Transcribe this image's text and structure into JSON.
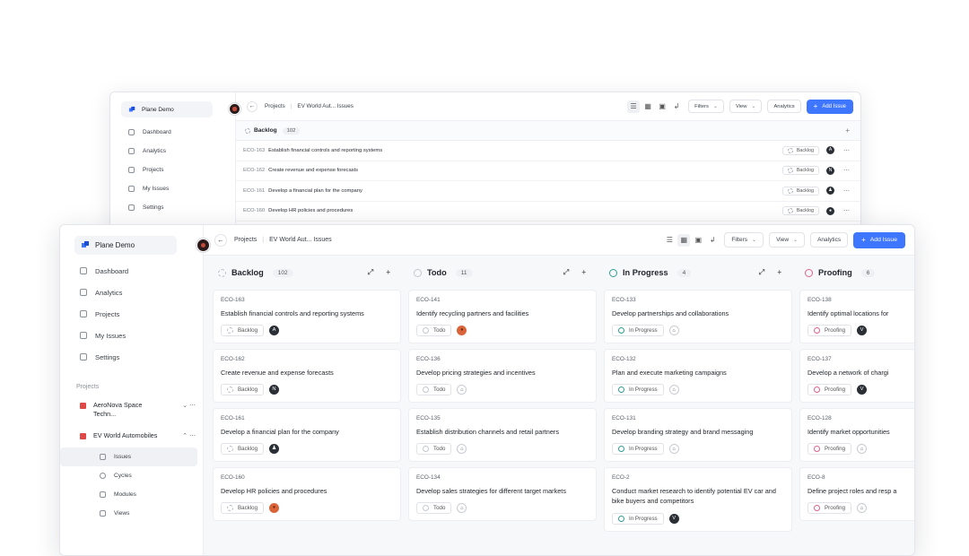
{
  "workspace": {
    "name": "Plane Demo"
  },
  "nav": [
    {
      "label": "Dashboard",
      "icon": "dashboard-icon"
    },
    {
      "label": "Analytics",
      "icon": "analytics-icon"
    },
    {
      "label": "Projects",
      "icon": "projects-icon"
    },
    {
      "label": "My Issues",
      "icon": "my-issues-icon"
    },
    {
      "label": "Settings",
      "icon": "settings-icon"
    }
  ],
  "sidebar": {
    "projects_heading": "Projects",
    "projects": [
      {
        "name": "AeroNova Space Techn...",
        "color": "#e04848",
        "expanded": false
      },
      {
        "name": "EV World Automobiles",
        "color": "#e04848",
        "expanded": true
      }
    ],
    "subnav": [
      {
        "label": "Issues",
        "icon": "issues-icon",
        "active": true
      },
      {
        "label": "Cycles",
        "icon": "cycles-icon",
        "active": false
      },
      {
        "label": "Modules",
        "icon": "modules-icon",
        "active": false
      },
      {
        "label": "Views",
        "icon": "views-icon",
        "active": false
      }
    ]
  },
  "header": {
    "crumb_projects": "Projects",
    "crumb_current": "EV World Aut... Issues",
    "filters_label": "Filters",
    "view_label": "View",
    "analytics_label": "Analytics",
    "add_issue_label": "Add Issue",
    "accent": "#3f76ff"
  },
  "list_view": {
    "group": "Backlog",
    "count": "102",
    "rows": [
      {
        "id": "ECO-163",
        "title": "Establish financial controls and reporting systems",
        "state": "Backlog",
        "assignee": "A"
      },
      {
        "id": "ECO-162",
        "title": "Create revenue and expense forecasts",
        "state": "Backlog",
        "assignee": "N"
      },
      {
        "id": "ECO-161",
        "title": "Develop a financial plan for the company",
        "state": "Backlog",
        "assignee": "♟"
      },
      {
        "id": "ECO-160",
        "title": "Develop HR policies and procedures",
        "state": "Backlog",
        "assignee": "●"
      }
    ]
  },
  "board": {
    "columns": [
      {
        "name": "Backlog",
        "count": "102",
        "color": "#b7bcc4",
        "dashed": true,
        "cards": [
          {
            "id": "ECO-163",
            "title": "Establish financial controls and reporting systems",
            "state": "Backlog",
            "assignee": "A"
          },
          {
            "id": "ECO-162",
            "title": "Create revenue and expense forecasts",
            "state": "Backlog",
            "assignee": "N"
          },
          {
            "id": "ECO-161",
            "title": "Develop a financial plan for the company",
            "state": "Backlog",
            "assignee": "♟"
          },
          {
            "id": "ECO-160",
            "title": "Develop HR policies and procedures",
            "state": "Backlog",
            "assignee": "●"
          }
        ]
      },
      {
        "name": "Todo",
        "count": "11",
        "color": "#c4c8ce",
        "dashed": false,
        "cards": [
          {
            "id": "ECO-141",
            "title": "Identify recycling partners and facilities",
            "state": "Todo",
            "assignee": "●"
          },
          {
            "id": "ECO-136",
            "title": "Develop pricing strategies and incentives",
            "state": "Todo",
            "assignee": "⌂"
          },
          {
            "id": "ECO-135",
            "title": "Establish distribution channels and retail partners",
            "state": "Todo",
            "assignee": "⌂"
          },
          {
            "id": "ECO-134",
            "title": "Develop sales strategies for different target markets",
            "state": "Todo",
            "assignee": "⌂"
          }
        ]
      },
      {
        "name": "In Progress",
        "count": "4",
        "color": "#2f9e8f",
        "dashed": false,
        "cards": [
          {
            "id": "ECO-133",
            "title": "Develop partnerships and collaborations",
            "state": "In Progress",
            "assignee": "⌂"
          },
          {
            "id": "ECO-132",
            "title": "Plan and execute marketing campaigns",
            "state": "In Progress",
            "assignee": "⌂"
          },
          {
            "id": "ECO-131",
            "title": "Develop branding strategy and brand messaging",
            "state": "In Progress",
            "assignee": "⌂"
          },
          {
            "id": "ECO-2",
            "title": "Conduct market research to identify potential EV car and bike buyers and competitors",
            "state": "In Progress",
            "assignee": "V"
          }
        ]
      },
      {
        "name": "Proofing",
        "count": "6",
        "color": "#e0608a",
        "dashed": false,
        "cards": [
          {
            "id": "ECO-138",
            "title": "Identify optimal locations for",
            "state": "Proofing",
            "assignee": "V"
          },
          {
            "id": "ECO-137",
            "title": "Develop a network of chargi",
            "state": "Proofing",
            "assignee": "V"
          },
          {
            "id": "ECO-128",
            "title": "Identify market opportunities",
            "state": "Proofing",
            "assignee": "⌂"
          },
          {
            "id": "ECO-8",
            "title": "Define project roles and resp a",
            "state": "Proofing",
            "assignee": "⌂"
          }
        ]
      }
    ]
  }
}
